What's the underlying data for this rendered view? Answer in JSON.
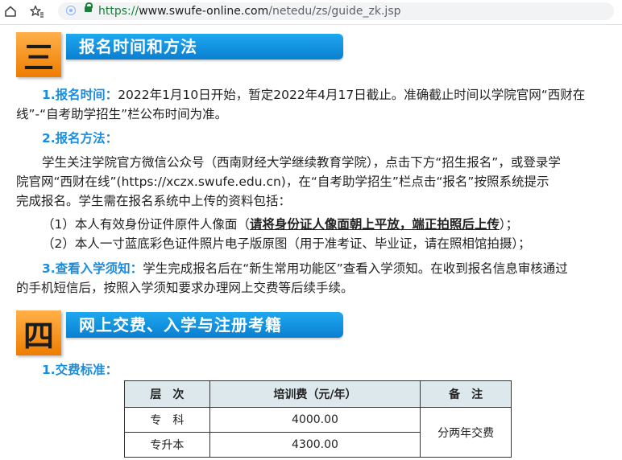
{
  "browser": {
    "url_protocol": "https://",
    "url_host": "www.swufe-online.com",
    "url_path": "/netedu/zs/guide_zk.jsp"
  },
  "section3": {
    "number": "三",
    "title": "报名时间和方法",
    "time_label": "1.报名时间：",
    "time_text_1": "2022年1月10日开始，暂定2022年4月17日截止。准确截止时间以学院官网“西财在",
    "time_text_2": "线”-“自考助学招生”栏公布时间为准。",
    "method_label": "2.报名方法：",
    "method_text_1": "学生关注学院官方微信公众号（西南财经大学继续教育学院），点击下方“招生报名”，或登录学",
    "method_text_2": "院官网“西财在线”(https://xczx.swufe.edu.cn)，在“自考助学招生”栏点击“报名”按照系统提示",
    "method_text_3": "完成报名。学生需在报名系统中上传的资料包括：",
    "item1_pre": "（1）本人有效身份证件原件人像面（",
    "item1_bold": "请将身份证人像面朝上平放，端正拍照后上传",
    "item1_post": "）；",
    "item2": "（2）本人一寸蓝底彩色证件照片电子版原图（用于准考证、毕业证，请在照相馆拍摄）；",
    "notice_label": "3.查看入学须知：",
    "notice_text_1": "学生完成报名后在“新生常用功能区”查看入学须知。在收到报名信息审核通过",
    "notice_text_2": "的手机短信后，按照入学须知要求办理网上交费等后续手续。"
  },
  "section4": {
    "number": "四",
    "title": "网上交费、入学与注册考籍",
    "fee_label": "1.交费标准："
  },
  "fee_table": {
    "headers": [
      "层　次",
      "培训费（元/年）",
      "备　注"
    ],
    "rows": [
      {
        "level": "专　科",
        "fee": "4000.00"
      },
      {
        "level": "专升本",
        "fee": "4300.00"
      }
    ],
    "note": "分两年交费"
  }
}
